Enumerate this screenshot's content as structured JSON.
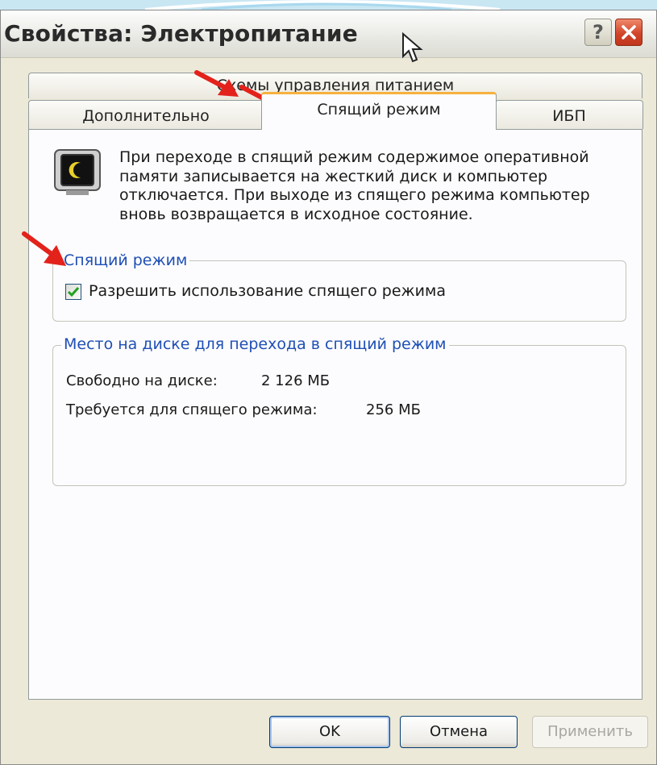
{
  "window": {
    "title": "Свойства: Электропитание"
  },
  "title_buttons": {
    "help": "?",
    "close": "✕"
  },
  "tabs": {
    "schemes": "Схемы управления питанием",
    "advanced": "Дополнительно",
    "sleep": "Спящий режим",
    "ups": "ИБП"
  },
  "description": "При переходе в спящий режим содержимое оперативной памяти записывается на жесткий диск и компьютер отключается. При выходе из спящего режима компьютер вновь возвращается в исходное состояние.",
  "hibernate_group": {
    "title": "Спящий режим",
    "checkbox_label": "Разрешить использование спящего режима",
    "checked": true
  },
  "disk_group": {
    "title": "Место на диске для перехода в спящий режим",
    "free_label": "Свободно на диске:",
    "free_value": "2 126 МБ",
    "required_label": "Требуется для спящего режима:",
    "required_value": "256 МБ"
  },
  "buttons": {
    "ok": "OK",
    "cancel": "Отмена",
    "apply": "Применить"
  },
  "colors": {
    "accent_arrow": "#e3221b",
    "group_title": "#1f4fb5",
    "active_tab_highlight": "#f6b13d"
  }
}
